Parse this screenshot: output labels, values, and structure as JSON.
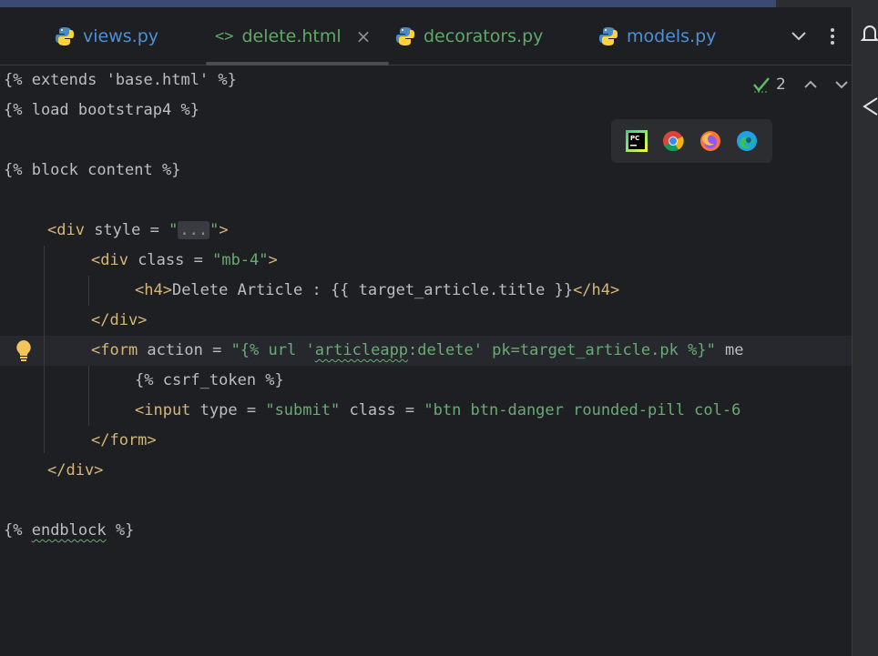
{
  "tabs": [
    {
      "label": "views.py",
      "icon": "python-icon",
      "active": false
    },
    {
      "label": "delete.html",
      "icon": "html-icon",
      "active": true,
      "close": "×"
    },
    {
      "label": "decorators.py",
      "icon": "python-icon",
      "active": false
    },
    {
      "label": "models.py",
      "icon": "python-icon",
      "active": false
    }
  ],
  "html_icon_glyph": "<>",
  "inspection": {
    "count": "2"
  },
  "browsers": [
    "pycharm-icon",
    "chrome-icon",
    "firefox-icon",
    "edge-icon"
  ],
  "code": {
    "l1": "{% extends 'base.html' %}",
    "l2": "{% load bootstrap4 %}",
    "l3": "{% block content %}",
    "l4": {
      "a": "<div ",
      "b": "style",
      "c": " = ",
      "d": "\"",
      "e": "...",
      "f": "\"",
      "g": ">"
    },
    "l5": {
      "a": "<div ",
      "b": "class",
      "c": " = ",
      "d": "\"mb-4\"",
      "e": ">"
    },
    "l6": {
      "a": "<h4>",
      "b": "Delete Article : {{ target_article.title }}",
      "c": "</h4>"
    },
    "l7": "</div>",
    "l8": {
      "a": "<form ",
      "b": "action",
      "c": " = ",
      "d": "\"{% url '",
      "e": "articleapp",
      "f": ":delete' pk=target_article.pk %}\"",
      "g": " me"
    },
    "l9": "{% csrf_token %}",
    "l10": {
      "a": "<input ",
      "b": "type",
      "c": " = ",
      "d": "\"submit\"",
      "e": " class",
      "f": " = ",
      "g": "\"btn btn-danger rounded-pill col-6"
    },
    "l11": "</form>",
    "l12": "</div>",
    "l13": {
      "a": "{% ",
      "b": "endblock",
      "c": " %}"
    }
  }
}
